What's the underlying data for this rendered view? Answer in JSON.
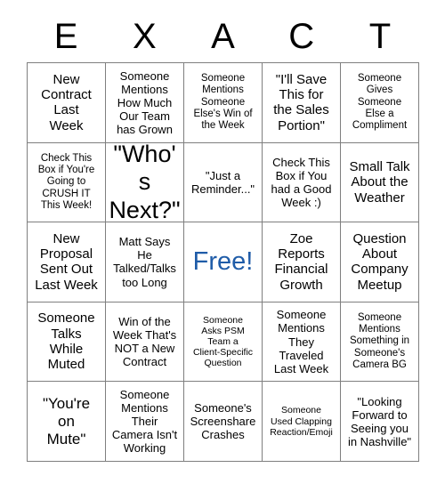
{
  "card": {
    "title_letters": [
      "E",
      "X",
      "A",
      "C",
      "T"
    ],
    "free_space_color": "#1f5ca8",
    "grid_line_color": "#7f7f7f",
    "rows": [
      [
        "New\nContract\nLast\nWeek",
        "Someone\nMentions\nHow Much\nOur Team\nhas Grown",
        "Someone\nMentions\nSomeone\nElse's Win of\nthe Week",
        "\"I'll Save\nThis for\nthe Sales\nPortion\"",
        "Someone\nGives\nSomeone\nElse a\nCompliment"
      ],
      [
        "Check This\nBox if You're\nGoing to\nCRUSH IT\nThis Week!",
        "\"Who's\nNext?\"",
        "\"Just a\nReminder...\"",
        "Check This\nBox if You\nhad a Good\nWeek :)",
        "Small Talk\nAbout the\nWeather"
      ],
      [
        "New\nProposal\nSent Out\nLast Week",
        "Matt Says\nHe\nTalked/Talks\ntoo Long",
        "Free!",
        "Zoe\nReports\nFinancial\nGrowth",
        "Question\nAbout\nCompany\nMeetup"
      ],
      [
        "Someone\nTalks\nWhile\nMuted",
        "Win of the\nWeek That's\nNOT a New\nContract",
        "Someone\nAsks PSM\nTeam a\nClient-Specific\nQuestion",
        "Someone\nMentions\nThey\nTraveled\nLast Week",
        "Someone\nMentions\nSomething in\nSomeone's\nCamera BG"
      ],
      [
        "\"You're\non\nMute\"",
        "Someone\nMentions\nTheir\nCamera Isn't\nWorking",
        "Someone's\nScreenshare\nCrashes",
        "Someone\nUsed Clapping\nReaction/Emoji",
        "\"Looking\nForward to\nSeeing you\nin Nashville\""
      ]
    ]
  }
}
